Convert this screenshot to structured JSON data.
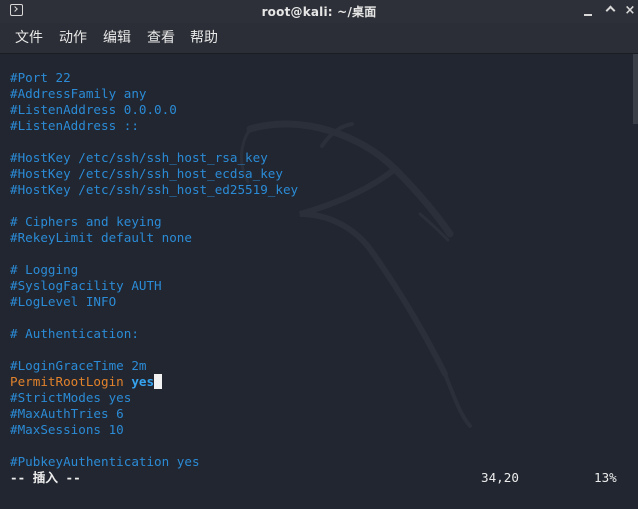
{
  "window": {
    "title": "root@kali: ~/桌面",
    "icon": "terminal-icon",
    "controls": [
      "minimize-icon",
      "maximize-icon",
      "close-icon"
    ],
    "close_glyph": "×"
  },
  "menu": {
    "items": [
      "文件",
      "动作",
      "编辑",
      "查看",
      "帮助"
    ]
  },
  "editor": {
    "lines": [
      "#Port 22",
      "#AddressFamily any",
      "#ListenAddress 0.0.0.0",
      "#ListenAddress ::",
      "",
      "#HostKey /etc/ssh/ssh_host_rsa_key",
      "#HostKey /etc/ssh/ssh_host_ecdsa_key",
      "#HostKey /etc/ssh/ssh_host_ed25519_key",
      "",
      "# Ciphers and keying",
      "#RekeyLimit default none",
      "",
      "# Logging",
      "#SyslogFacility AUTH",
      "#LogLevel INFO",
      "",
      "# Authentication:",
      "",
      "#LoginGraceTime 2m",
      "",
      "#StrictModes yes",
      "#MaxAuthTries 6",
      "#MaxSessions 10",
      "",
      "#PubkeyAuthentication yes"
    ],
    "active_line": {
      "keyword": "PermitRootLogin",
      "value": "yes"
    },
    "colors": {
      "comment": "#2b8bd6",
      "keyword": "#e2822b",
      "value": "#36a3ef",
      "background": "#212630"
    }
  },
  "status": {
    "mode": "-- 插入 --",
    "position": "34,20",
    "percent": "13%"
  }
}
